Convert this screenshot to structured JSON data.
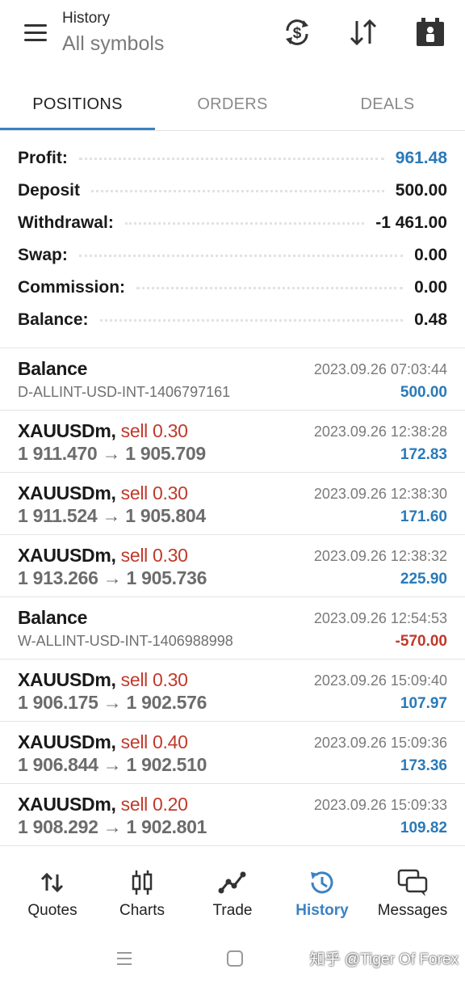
{
  "header": {
    "title": "History",
    "subtitle": "All symbols",
    "icons": [
      "currency-exchange-icon",
      "sort-icon",
      "calendar-icon"
    ]
  },
  "tabs": [
    {
      "label": "POSITIONS",
      "active": true
    },
    {
      "label": "ORDERS",
      "active": false
    },
    {
      "label": "DEALS",
      "active": false
    }
  ],
  "summary": [
    {
      "label": "Profit:",
      "value": "961.48",
      "color": "#2a7ab8"
    },
    {
      "label": "Deposit",
      "value": "500.00",
      "color": "#1a1a1a"
    },
    {
      "label": "Withdrawal:",
      "value": "-1 461.00",
      "color": "#1a1a1a"
    },
    {
      "label": "Swap:",
      "value": "0.00",
      "color": "#1a1a1a"
    },
    {
      "label": "Commission:",
      "value": "0.00",
      "color": "#1a1a1a"
    },
    {
      "label": "Balance:",
      "value": "0.48",
      "color": "#1a1a1a"
    }
  ],
  "deals": [
    {
      "type": "balance",
      "title": "Balance",
      "sub": "D-ALLINT-USD-INT-1406797161",
      "datetime": "2023.09.26 07:03:44",
      "amount": "500.00",
      "negative": false
    },
    {
      "type": "trade",
      "symbol": "XAUUSDm,",
      "side": "sell 0.30",
      "open": "1 911.470",
      "arrow": "→",
      "close": "1 905.709",
      "datetime": "2023.09.26 12:38:28",
      "amount": "172.83",
      "negative": false
    },
    {
      "type": "trade",
      "symbol": "XAUUSDm,",
      "side": "sell 0.30",
      "open": "1 911.524",
      "arrow": "→",
      "close": "1 905.804",
      "datetime": "2023.09.26 12:38:30",
      "amount": "171.60",
      "negative": false
    },
    {
      "type": "trade",
      "symbol": "XAUUSDm,",
      "side": "sell 0.30",
      "open": "1 913.266",
      "arrow": "→",
      "close": "1 905.736",
      "datetime": "2023.09.26 12:38:32",
      "amount": "225.90",
      "negative": false
    },
    {
      "type": "balance",
      "title": "Balance",
      "sub": "W-ALLINT-USD-INT-1406988998",
      "datetime": "2023.09.26 12:54:53",
      "amount": "-570.00",
      "negative": true
    },
    {
      "type": "trade",
      "symbol": "XAUUSDm,",
      "side": "sell 0.30",
      "open": "1 906.175",
      "arrow": "→",
      "close": "1 902.576",
      "datetime": "2023.09.26 15:09:40",
      "amount": "107.97",
      "negative": false
    },
    {
      "type": "trade",
      "symbol": "XAUUSDm,",
      "side": "sell 0.40",
      "open": "1 906.844",
      "arrow": "→",
      "close": "1 902.510",
      "datetime": "2023.09.26 15:09:36",
      "amount": "173.36",
      "negative": false
    },
    {
      "type": "trade",
      "symbol": "XAUUSDm,",
      "side": "sell 0.20",
      "open": "1 908.292",
      "arrow": "→",
      "close": "1 902.801",
      "datetime": "2023.09.26 15:09:33",
      "amount": "109.82",
      "negative": false
    }
  ],
  "bottom_nav": [
    {
      "label": "Quotes",
      "icon": "quotes-icon",
      "active": false
    },
    {
      "label": "Charts",
      "icon": "charts-icon",
      "active": false
    },
    {
      "label": "Trade",
      "icon": "trade-icon",
      "active": false
    },
    {
      "label": "History",
      "icon": "history-icon",
      "active": true
    },
    {
      "label": "Messages",
      "icon": "messages-icon",
      "active": false
    }
  ],
  "watermark": "知乎 @Tiger Of Forex",
  "colors": {
    "accent": "#3b82c4",
    "profit": "#2a7ab8",
    "loss": "#c0392b"
  }
}
